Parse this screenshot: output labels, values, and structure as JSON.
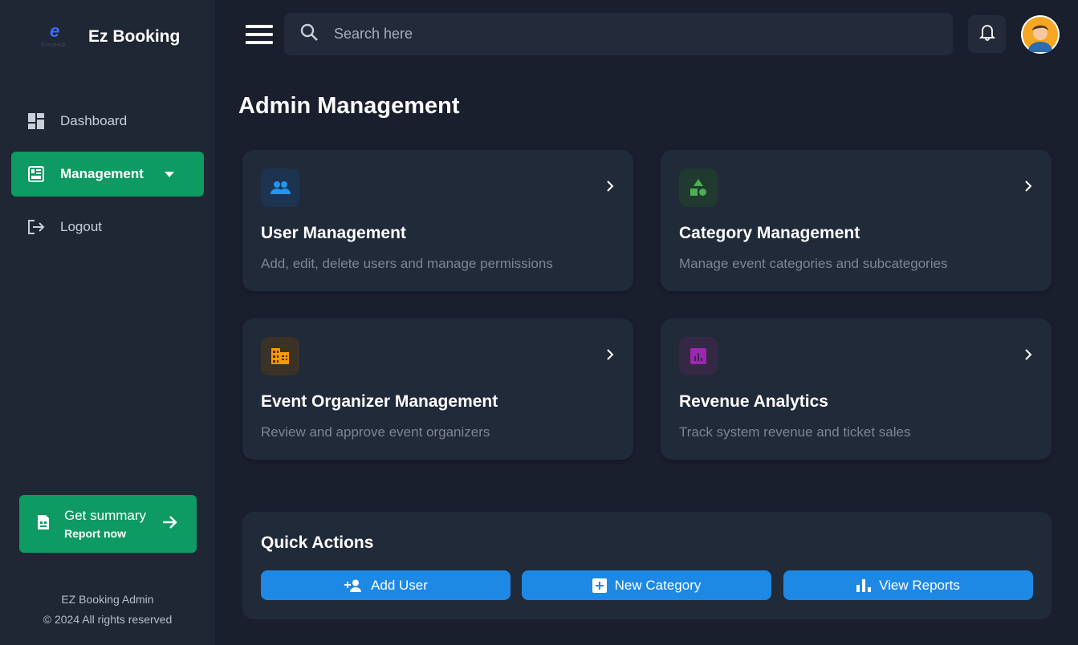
{
  "brand": {
    "name": "Ez Booking",
    "logo_letter": "e",
    "logo_sub": "EventHub"
  },
  "sidebar": {
    "items": [
      {
        "label": "Dashboard",
        "icon": "dashboard-icon"
      },
      {
        "label": "Management",
        "icon": "management-icon",
        "active": true
      },
      {
        "label": "Logout",
        "icon": "logout-icon"
      }
    ],
    "summary": {
      "title": "Get summary",
      "subtitle": "Report now"
    },
    "footer_line1": "EZ Booking Admin",
    "footer_line2": "© 2024 All rights reserved"
  },
  "header": {
    "search_placeholder": "Search here"
  },
  "page_title": "Admin Management",
  "cards": [
    {
      "title": "User Management",
      "description": "Add, edit, delete users and manage permissions",
      "icon": "users-icon",
      "accent": "#2196f3"
    },
    {
      "title": "Category Management",
      "description": "Manage event categories and subcategories",
      "icon": "category-icon",
      "accent": "#4caf50"
    },
    {
      "title": "Event Organizer Management",
      "description": "Review and approve event organizers",
      "icon": "building-icon",
      "accent": "#ff9800"
    },
    {
      "title": "Revenue Analytics",
      "description": "Track system revenue and ticket sales",
      "icon": "analytics-icon",
      "accent": "#9c27b0"
    }
  ],
  "quick_actions": {
    "title": "Quick Actions",
    "buttons": [
      {
        "label": "Add User",
        "icon": "person-add-icon"
      },
      {
        "label": "New Category",
        "icon": "add-box-icon"
      },
      {
        "label": "View Reports",
        "icon": "bar-chart-icon"
      }
    ]
  },
  "colors": {
    "sidebar_bg": "#1f2735",
    "page_bg": "#1a1f2e",
    "active": "#0e9a63",
    "button": "#1e88e5"
  }
}
